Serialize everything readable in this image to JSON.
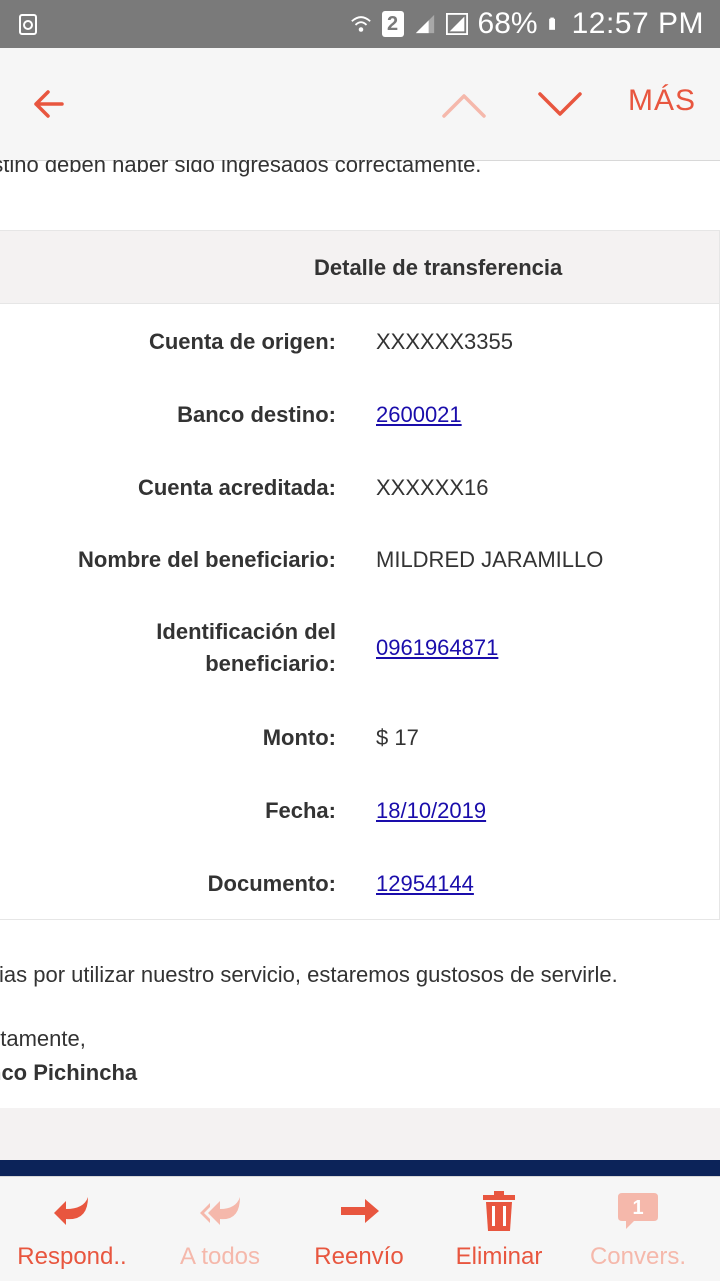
{
  "status_bar": {
    "sim": "2",
    "battery": "68%",
    "time": "12:57 PM"
  },
  "app_bar": {
    "more_label": "MÁS"
  },
  "email": {
    "intro_fragment": "estino deben haber sido ingresados correctamente.",
    "transfer_title": "Detalle de transferencia",
    "rows": [
      {
        "label": "Cuenta de origen:",
        "value": "XXXXXX3355",
        "link": false
      },
      {
        "label": "Banco destino:",
        "value": "2600021",
        "link": true
      },
      {
        "label": "Cuenta acreditada:",
        "value": "XXXXXX16",
        "link": false
      },
      {
        "label": "Nombre del beneficiario:",
        "value": "MILDRED JARAMILLO",
        "link": false
      },
      {
        "label_line1": "Identificación del",
        "label_line2": "beneficiario:",
        "value": "0961964871",
        "link": true
      },
      {
        "label": "Monto:",
        "value": "$ 17",
        "link": false
      },
      {
        "label": "Fecha:",
        "value": "18/10/2019",
        "link": true
      },
      {
        "label": "Documento:",
        "value": "12954144",
        "link": true
      }
    ],
    "thanks": "cias por utilizar nuestro servicio, estaremos gustosos de servirle.",
    "closing": "ntamente,",
    "signature": "nco Pichincha"
  },
  "actions": [
    {
      "label": "Respond..",
      "icon": "reply-icon",
      "enabled": true
    },
    {
      "label": "A todos",
      "icon": "reply-all-icon",
      "enabled": false
    },
    {
      "label": "Reenvío",
      "icon": "forward-icon",
      "enabled": true
    },
    {
      "label": "Eliminar",
      "icon": "trash-icon",
      "enabled": true
    },
    {
      "label": "Convers.",
      "icon": "conversation-icon",
      "enabled": false,
      "badge": "1"
    }
  ],
  "colors": {
    "accent": "#e8563f",
    "accent_disabled": "#f5b8ab",
    "link": "#1a0dab",
    "status_bar": "#7a7a7a",
    "navy": "#0c2359"
  }
}
